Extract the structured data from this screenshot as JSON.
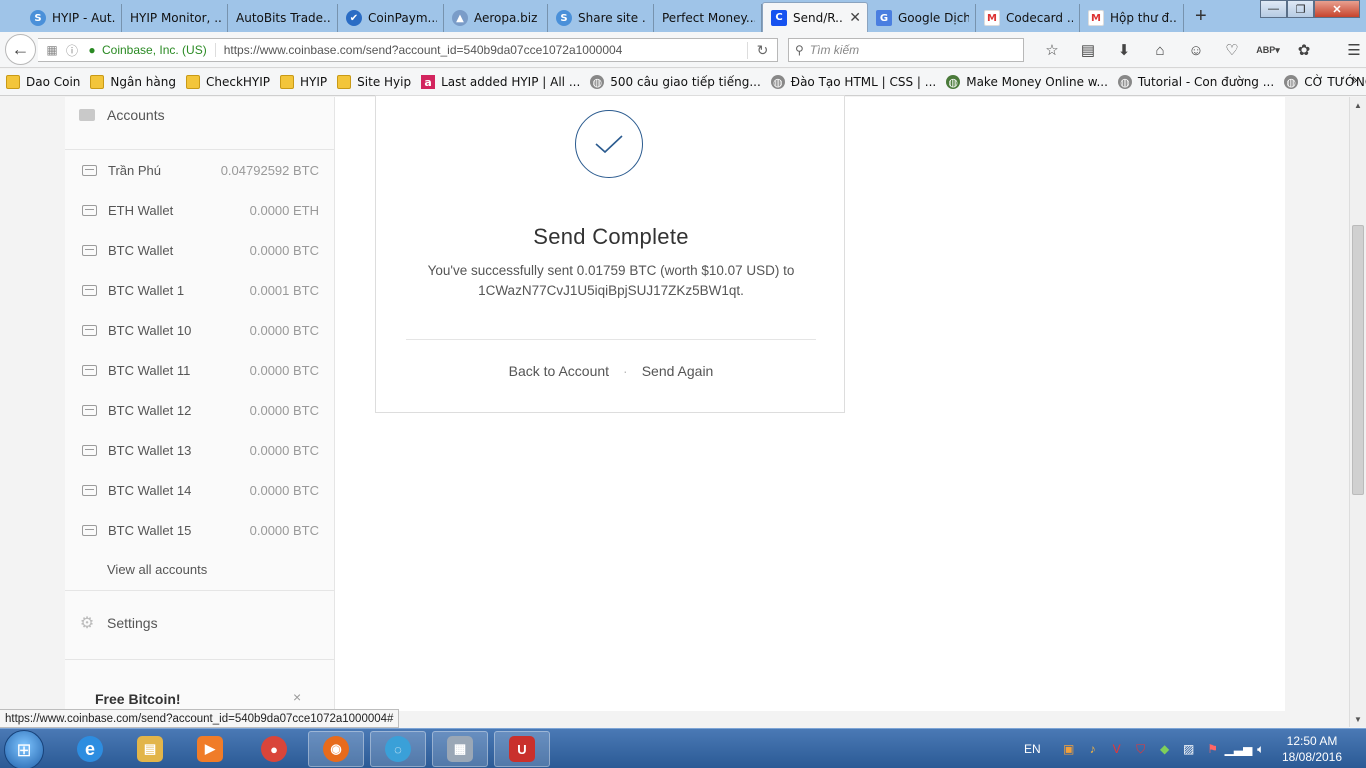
{
  "browser": {
    "tabs": [
      {
        "title": "HYIP - Aut...",
        "fav_color": "#4a90d9",
        "fav_char": "S"
      },
      {
        "title": "HYIP Monitor, ...",
        "fav_color": "",
        "fav_char": ""
      },
      {
        "title": "AutoBits Trade...",
        "fav_color": "",
        "fav_char": ""
      },
      {
        "title": "CoinPaym...",
        "fav_color": "#2a6cc4",
        "fav_char": "✔"
      },
      {
        "title": "Aeropa.biz",
        "fav_color": "#7a9cc8",
        "fav_char": "▲"
      },
      {
        "title": "Share site ...",
        "fav_color": "#4a90d9",
        "fav_char": "S"
      },
      {
        "title": "Perfect Money...",
        "fav_color": "",
        "fav_char": ""
      },
      {
        "title": "Send/R...",
        "fav_color": "#1652f0",
        "fav_char": "C",
        "active": true
      },
      {
        "title": "Google Dịch",
        "fav_color": "#4a7ee0",
        "fav_char": "G"
      },
      {
        "title": "Codecard ...",
        "fav_color": "#d33",
        "fav_char": "M"
      },
      {
        "title": "Hộp thư đ...",
        "fav_color": "#d33",
        "fav_char": "M"
      }
    ],
    "new_tab_glyph": "+",
    "window_buttons": {
      "minimize": "—",
      "maximize": "❐",
      "close": "✕"
    },
    "org_label": "Coinbase, Inc. (US)",
    "url": "https://www.coinbase.com/send?account_id=540b9da07cce1072a1000004",
    "search_placeholder": "Tìm kiếm",
    "toolbar_icons": [
      "bookmark-star-icon",
      "reading-list-icon",
      "download-icon",
      "home-icon",
      "chat-icon",
      "pocket-icon",
      "adblock-icon",
      "extension-icon",
      "menu-icon"
    ],
    "bookmarks": [
      {
        "label": "Dao Coin",
        "icon": "folder"
      },
      {
        "label": "Ngân hàng",
        "icon": "folder"
      },
      {
        "label": "CheckHYIP",
        "icon": "folder"
      },
      {
        "label": "HYIP",
        "icon": "folder"
      },
      {
        "label": "Site Hyip",
        "icon": "folder"
      },
      {
        "label": "Last added HYIP | All ...",
        "icon": "red-a"
      },
      {
        "label": "500 câu giao tiếp tiếng...",
        "icon": "globe"
      },
      {
        "label": "Đào Tạo HTML | CSS | ...",
        "icon": "globe"
      },
      {
        "label": "Make Money Online w...",
        "icon": "globe"
      },
      {
        "label": "Tutorial - Con đường ...",
        "icon": "globe"
      },
      {
        "label": "CỜ TƯỚNG: CHUYÊN ...",
        "icon": "globe"
      }
    ],
    "status_url": "https://www.coinbase.com/send?account_id=540b9da07cce1072a1000004#"
  },
  "sidebar": {
    "accounts_heading": "Accounts",
    "accounts": [
      {
        "name": "Trần Phú",
        "balance": "0.04792592 BTC"
      },
      {
        "name": "ETH Wallet",
        "balance": "0.0000 ETH"
      },
      {
        "name": "BTC Wallet",
        "balance": "0.0000 BTC"
      },
      {
        "name": "BTC Wallet 1",
        "balance": "0.0001 BTC"
      },
      {
        "name": "BTC Wallet 10",
        "balance": "0.0000 BTC"
      },
      {
        "name": "BTC Wallet 11",
        "balance": "0.0000 BTC"
      },
      {
        "name": "BTC Wallet 12",
        "balance": "0.0000 BTC"
      },
      {
        "name": "BTC Wallet 13",
        "balance": "0.0000 BTC"
      },
      {
        "name": "BTC Wallet 14",
        "balance": "0.0000 BTC"
      },
      {
        "name": "BTC Wallet 15",
        "balance": "0.0000 BTC"
      }
    ],
    "view_all": "View all accounts",
    "settings": "Settings",
    "promo_title": "Free Bitcoin!",
    "promo_close": "×"
  },
  "main": {
    "title": "Send Complete",
    "message_line1": "You've successfully sent 0.01759 BTC (worth $10.07 USD) to",
    "message_line2": "1CWazN77CvJ1U5iqiBpjSUJ17ZKz5BW1qt.",
    "back_link": "Back to Account",
    "separator": "·",
    "send_again_link": "Send Again",
    "accent_color": "#2b5b8f"
  },
  "taskbar": {
    "apps": [
      {
        "name": "internet-explorer",
        "glyph": "e",
        "color": "#2d8de0"
      },
      {
        "name": "file-explorer",
        "glyph": "▤",
        "color": "#e2b54a"
      },
      {
        "name": "media-player",
        "glyph": "▶",
        "color": "#f07c28"
      },
      {
        "name": "chrome",
        "glyph": "●",
        "color": "#d9453a"
      },
      {
        "name": "firefox",
        "glyph": "◉",
        "color": "#e76b1c",
        "open": true
      },
      {
        "name": "app-swirl",
        "glyph": "◌",
        "color": "#3aa0d8",
        "open": true
      },
      {
        "name": "calculator",
        "glyph": "▦",
        "color": "#9aa7b6",
        "open": true
      },
      {
        "name": "unikey",
        "glyph": "U",
        "color": "#c9302c",
        "open": true
      }
    ],
    "language": "EN",
    "time": "12:50 AM",
    "date": "18/08/2016"
  }
}
